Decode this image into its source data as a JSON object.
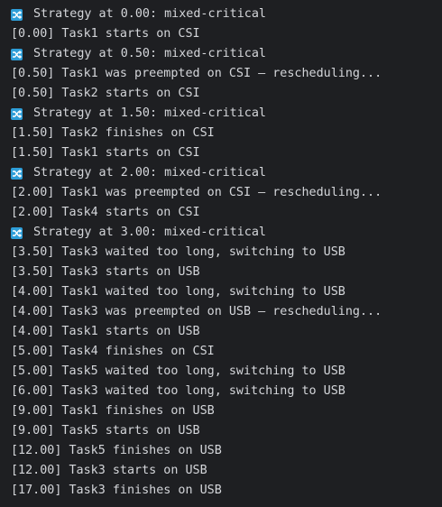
{
  "console": {
    "lines": [
      {
        "icon": "shuffle-icon",
        "text": "Strategy at 0.00: mixed-critical"
      },
      {
        "icon": null,
        "text": "[0.00] Task1 starts on CSI"
      },
      {
        "icon": "shuffle-icon",
        "text": "Strategy at 0.50: mixed-critical"
      },
      {
        "icon": null,
        "text": "[0.50] Task1 was preempted on CSI — rescheduling..."
      },
      {
        "icon": null,
        "text": "[0.50] Task2 starts on CSI"
      },
      {
        "icon": "shuffle-icon",
        "text": "Strategy at 1.50: mixed-critical"
      },
      {
        "icon": null,
        "text": "[1.50] Task2 finishes on CSI"
      },
      {
        "icon": null,
        "text": "[1.50] Task1 starts on CSI"
      },
      {
        "icon": "shuffle-icon",
        "text": "Strategy at 2.00: mixed-critical"
      },
      {
        "icon": null,
        "text": "[2.00] Task1 was preempted on CSI — rescheduling..."
      },
      {
        "icon": null,
        "text": "[2.00] Task4 starts on CSI"
      },
      {
        "icon": "shuffle-icon",
        "text": "Strategy at 3.00: mixed-critical"
      },
      {
        "icon": null,
        "text": "[3.50] Task3 waited too long, switching to USB"
      },
      {
        "icon": null,
        "text": "[3.50] Task3 starts on USB"
      },
      {
        "icon": null,
        "text": "[4.00] Task1 waited too long, switching to USB"
      },
      {
        "icon": null,
        "text": "[4.00] Task3 was preempted on USB — rescheduling..."
      },
      {
        "icon": null,
        "text": "[4.00] Task1 starts on USB"
      },
      {
        "icon": null,
        "text": "[5.00] Task4 finishes on CSI"
      },
      {
        "icon": null,
        "text": "[5.00] Task5 waited too long, switching to USB"
      },
      {
        "icon": null,
        "text": "[6.00] Task3 waited too long, switching to USB"
      },
      {
        "icon": null,
        "text": "[9.00] Task1 finishes on USB"
      },
      {
        "icon": null,
        "text": "[9.00] Task5 starts on USB"
      },
      {
        "icon": null,
        "text": "[12.00] Task5 finishes on USB"
      },
      {
        "icon": null,
        "text": "[12.00] Task3 starts on USB"
      },
      {
        "icon": null,
        "text": "[17.00] Task3 finishes on USB"
      }
    ]
  },
  "colors": {
    "background": "#1e1f22",
    "text": "#d4d6da",
    "icon_bg": "#2e9ed8"
  }
}
